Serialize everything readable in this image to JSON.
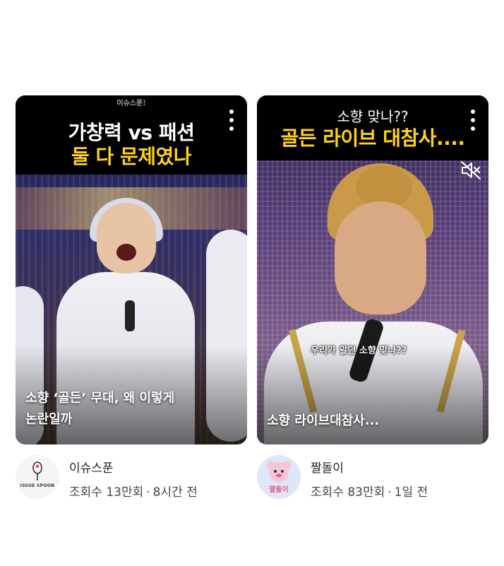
{
  "cards": [
    {
      "watermark": "이슈스푼!",
      "title_line1": "가창력 vs 패션",
      "title_line2": "둘 다 문제였나",
      "caption_line1": "소향 ‘골든’ 무대, 왜 이렇게",
      "caption_line2": "논란일까",
      "menu_icon": "more-vert-icon",
      "channel": "이슈스푼",
      "avatar_text": "ISSUE SPOON",
      "views": "조회수 13만회",
      "time": "8시간 전"
    },
    {
      "title_line1": "소향 맞나??",
      "title_line2": "골든 라이브 대참사....",
      "subtitle": "우리가 알던 소향 맞나??",
      "caption_line1": "소향 라이브대참사...",
      "menu_icon": "more-vert-icon",
      "mute_icon": "volume-off-icon",
      "channel": "짤돌이",
      "avatar_text": "짤돌이",
      "views": "조회수 83만회",
      "time": "1일 전"
    }
  ],
  "separator": "·",
  "colors": {
    "title_highlight": "#ffd21f",
    "title_band": "#000000",
    "text_primary": "#222222",
    "text_secondary": "#444444"
  }
}
